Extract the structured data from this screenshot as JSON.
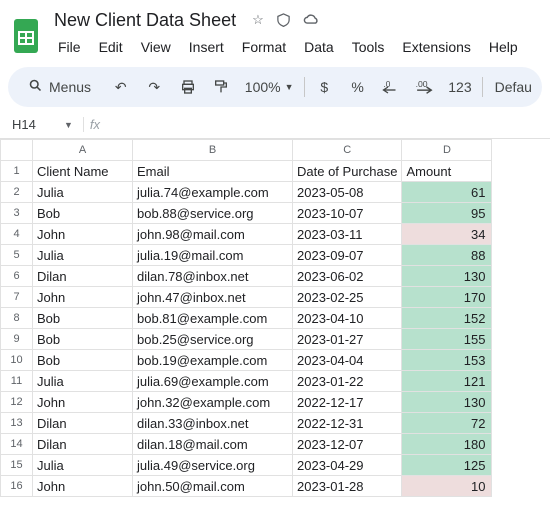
{
  "doc": {
    "title": "New Client Data Sheet"
  },
  "menus": [
    "File",
    "Edit",
    "View",
    "Insert",
    "Format",
    "Data",
    "Tools",
    "Extensions",
    "Help"
  ],
  "toolbar": {
    "search_label": "Menus",
    "zoom": "100%",
    "dollar": "$",
    "percent": "%",
    "decrease_dec": ".0",
    "increase_dec": ".00",
    "num_fmt": "123",
    "font": "Defau"
  },
  "namebox": {
    "cell": "H14",
    "formula": ""
  },
  "columns": [
    "A",
    "B",
    "C",
    "D"
  ],
  "headers": {
    "A": "Client Name",
    "B": "Email",
    "C": "Date of Purchase",
    "D": "Amount"
  },
  "rows": [
    {
      "n": 2,
      "a": "Julia",
      "b": "julia.74@example.com",
      "c": "2023-05-08",
      "d": "61",
      "hl": "green"
    },
    {
      "n": 3,
      "a": "Bob",
      "b": "bob.88@service.org",
      "c": "2023-10-07",
      "d": "95",
      "hl": "green"
    },
    {
      "n": 4,
      "a": "John",
      "b": "john.98@mail.com",
      "c": "2023-03-11",
      "d": "34",
      "hl": "red"
    },
    {
      "n": 5,
      "a": "Julia",
      "b": "julia.19@mail.com",
      "c": "2023-09-07",
      "d": "88",
      "hl": "green"
    },
    {
      "n": 6,
      "a": "Dilan",
      "b": "dilan.78@inbox.net",
      "c": "2023-06-02",
      "d": "130",
      "hl": "green"
    },
    {
      "n": 7,
      "a": "John",
      "b": "john.47@inbox.net",
      "c": "2023-02-25",
      "d": "170",
      "hl": "green"
    },
    {
      "n": 8,
      "a": "Bob",
      "b": "bob.81@example.com",
      "c": "2023-04-10",
      "d": "152",
      "hl": "green"
    },
    {
      "n": 9,
      "a": "Bob",
      "b": "bob.25@service.org",
      "c": "2023-01-27",
      "d": "155",
      "hl": "green"
    },
    {
      "n": 10,
      "a": "Bob",
      "b": "bob.19@example.com",
      "c": "2023-04-04",
      "d": "153",
      "hl": "green"
    },
    {
      "n": 11,
      "a": "Julia",
      "b": "julia.69@example.com",
      "c": "2023-01-22",
      "d": "121",
      "hl": "green"
    },
    {
      "n": 12,
      "a": "John",
      "b": "john.32@example.com",
      "c": "2022-12-17",
      "d": "130",
      "hl": "green"
    },
    {
      "n": 13,
      "a": "Dilan",
      "b": "dilan.33@inbox.net",
      "c": "2022-12-31",
      "d": "72",
      "hl": "green"
    },
    {
      "n": 14,
      "a": "Dilan",
      "b": "dilan.18@mail.com",
      "c": "2023-12-07",
      "d": "180",
      "hl": "green",
      "selected": true
    },
    {
      "n": 15,
      "a": "Julia",
      "b": "julia.49@service.org",
      "c": "2023-04-29",
      "d": "125",
      "hl": "green"
    },
    {
      "n": 16,
      "a": "John",
      "b": "john.50@mail.com",
      "c": "2023-01-28",
      "d": "10",
      "hl": "red"
    }
  ]
}
